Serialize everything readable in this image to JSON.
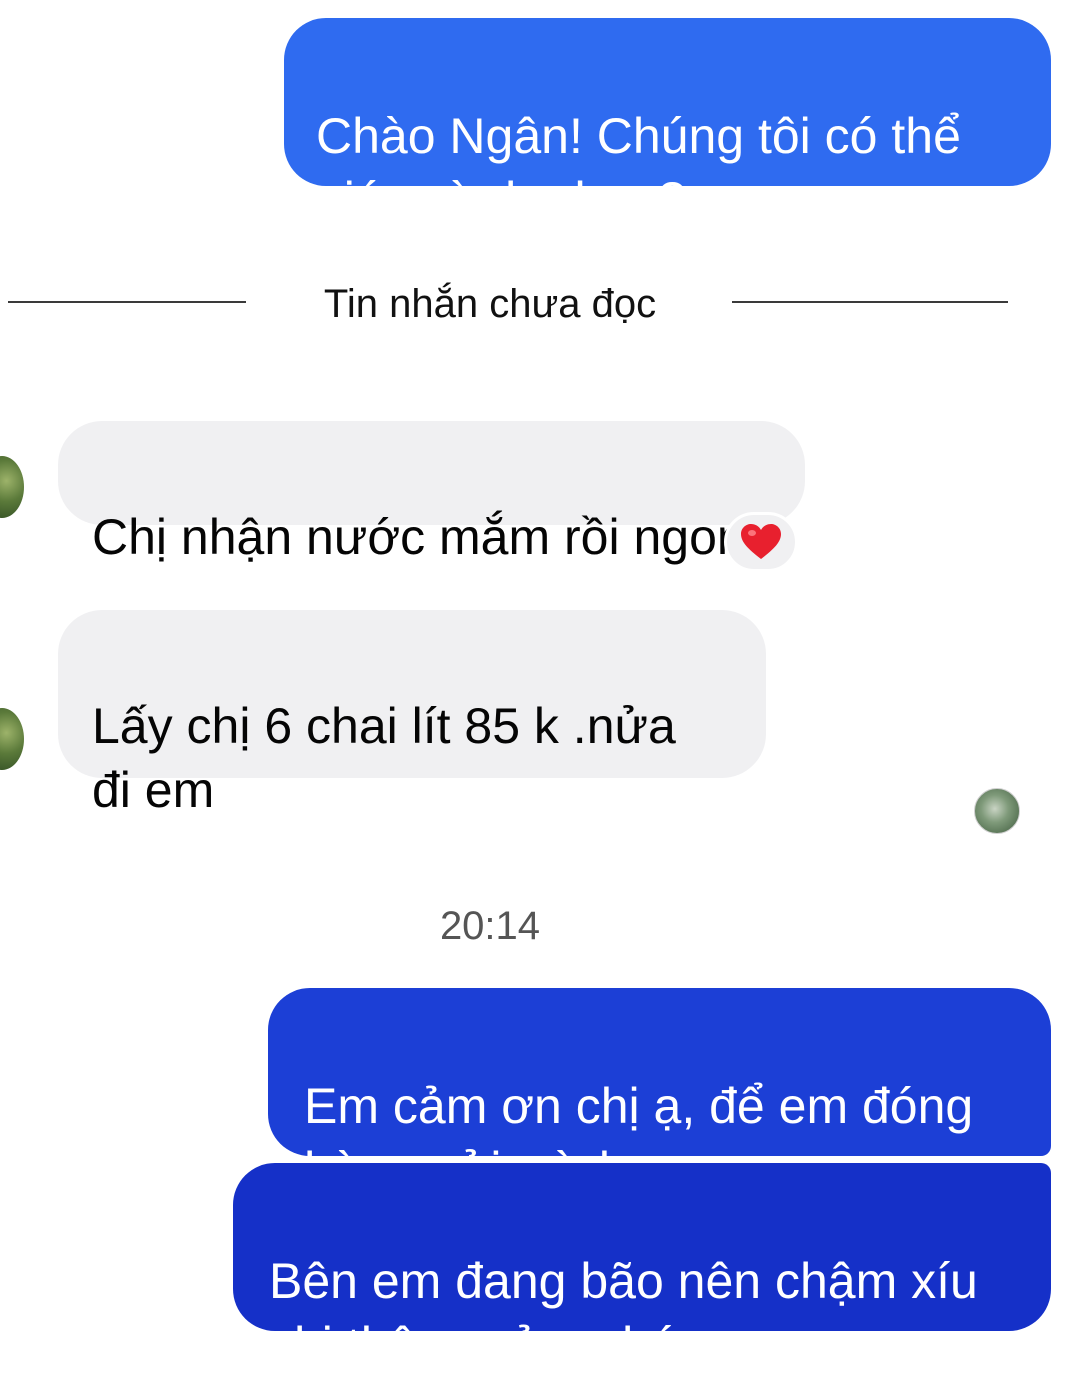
{
  "colors": {
    "outgoing_bubble_1": "#2f6bf0",
    "outgoing_bubble_2": "#1c3fd6",
    "outgoing_bubble_3": "#1530c8",
    "incoming_bubble": "#f0f0f2",
    "reaction_heart": "#e8202e"
  },
  "messages": [
    {
      "direction": "outgoing",
      "text": "Chào Ngân! Chúng tôi có thể\ngiúp gì cho bạn?"
    },
    {
      "direction": "incoming",
      "text": "Chị nhận nước mắm rồi ngon",
      "reaction": "heart-icon"
    },
    {
      "direction": "incoming",
      "text": "Lấy chị 6 chai lít 85  k .nửa\nđi em"
    },
    {
      "direction": "outgoing",
      "text": "Em cảm ơn chị ạ, để em đóng\nhàng gửi mình ạ"
    },
    {
      "direction": "outgoing",
      "text": "Bên em đang bão nên chậm xíu\nchị thông cảm nhé"
    }
  ],
  "divider": {
    "label": "Tin nhắn chưa đọc"
  },
  "timestamp": "20:14",
  "icons": {
    "reaction": "heart-icon",
    "contact_avatar": "avatar",
    "read_receipt": "read-receipt-avatar"
  }
}
